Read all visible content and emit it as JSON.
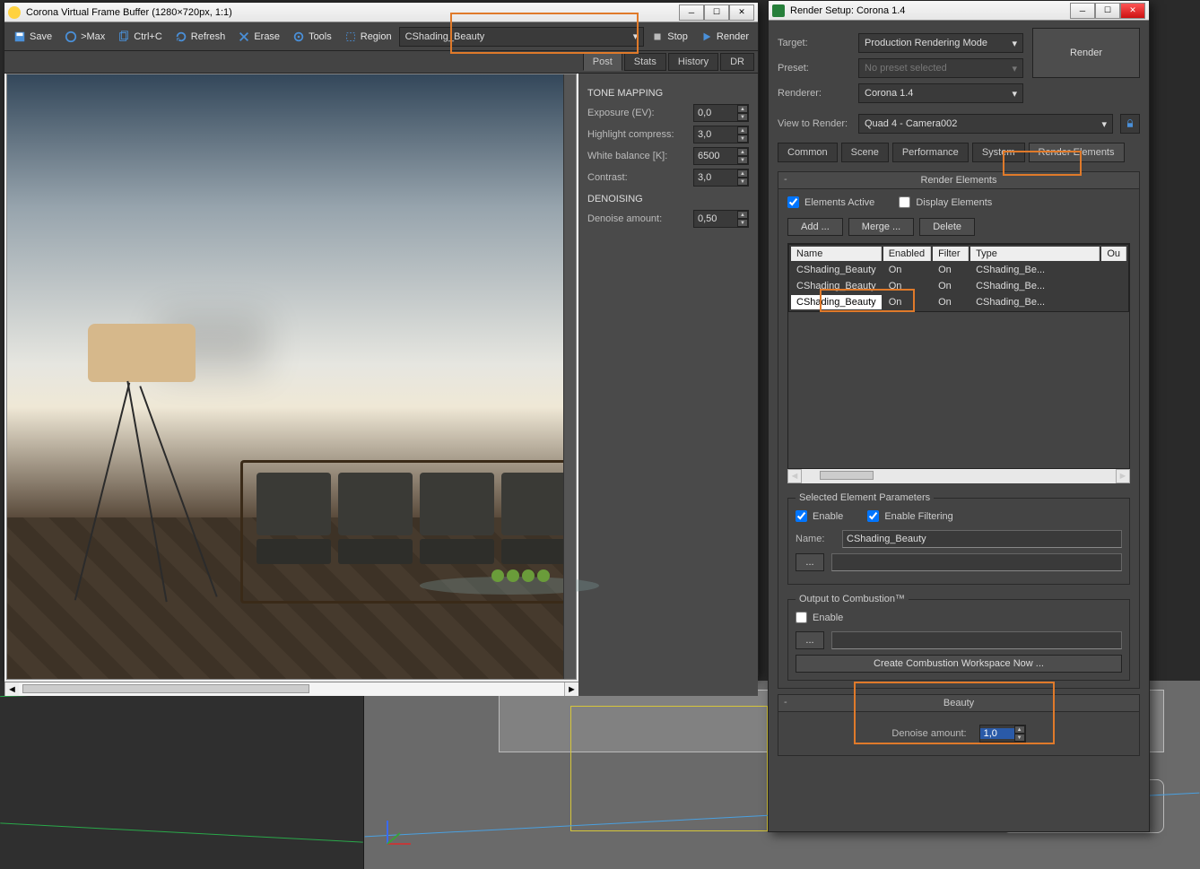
{
  "vfb": {
    "title": "Corona Virtual Frame Buffer (1280×720px, 1:1)",
    "toolbar": {
      "save": "Save",
      "max": ">Max",
      "ctrlc": "Ctrl+C",
      "refresh": "Refresh",
      "erase": "Erase",
      "tools": "Tools",
      "region": "Region",
      "pass_dropdown": "CShading_Beauty",
      "stop": "Stop",
      "render": "Render"
    },
    "tabs": {
      "post": "Post",
      "stats": "Stats",
      "history": "History",
      "dr": "DR"
    },
    "panel": {
      "tone_mapping": "TONE MAPPING",
      "exposure_label": "Exposure (EV):",
      "exposure_value": "0,0",
      "highlight_label": "Highlight compress:",
      "highlight_value": "3,0",
      "wb_label": "White balance [K]:",
      "wb_value": "6500",
      "contrast_label": "Contrast:",
      "contrast_value": "3,0",
      "denoising": "DENOISING",
      "denoise_label": "Denoise amount:",
      "denoise_value": "0,50"
    }
  },
  "rs": {
    "title": "Render Setup: Corona 1.4",
    "target_label": "Target:",
    "target_value": "Production Rendering Mode",
    "preset_label": "Preset:",
    "preset_placeholder": "No preset selected",
    "renderer_label": "Renderer:",
    "renderer_value": "Corona 1.4",
    "view_label": "View to Render:",
    "view_value": "Quad 4 - Camera002",
    "render_btn": "Render",
    "tabs": {
      "common": "Common",
      "scene": "Scene",
      "performance": "Performance",
      "system": "System",
      "re": "Render Elements"
    },
    "re_group": "Render Elements",
    "elements_active": "Elements Active",
    "display_elements": "Display Elements",
    "add": "Add ...",
    "merge": "Merge ...",
    "delete": "Delete",
    "cols": {
      "name": "Name",
      "enabled": "Enabled",
      "filter": "Filter",
      "type": "Type",
      "out": "Ou"
    },
    "rows": [
      {
        "name": "CShading_Beauty",
        "enabled": "On",
        "filter": "On",
        "type": "CShading_Be..."
      },
      {
        "name": "CShading_Beauty",
        "enabled": "On",
        "filter": "On",
        "type": "CShading_Be..."
      },
      {
        "name": "CShading_Beauty",
        "enabled": "On",
        "filter": "On",
        "type": "CShading_Be..."
      }
    ],
    "sel_params": "Selected Element Parameters",
    "enable": "Enable",
    "enable_filtering": "Enable Filtering",
    "name_label": "Name:",
    "name_value": "CShading_Beauty",
    "dots": "...",
    "combustion_head": "Output to Combustion™",
    "combustion_enable": "Enable",
    "combustion_btn": "Create Combustion Workspace Now ...",
    "beauty_head": "Beauty",
    "denoise_label": "Denoise amount:",
    "denoise_value": "1,0"
  }
}
